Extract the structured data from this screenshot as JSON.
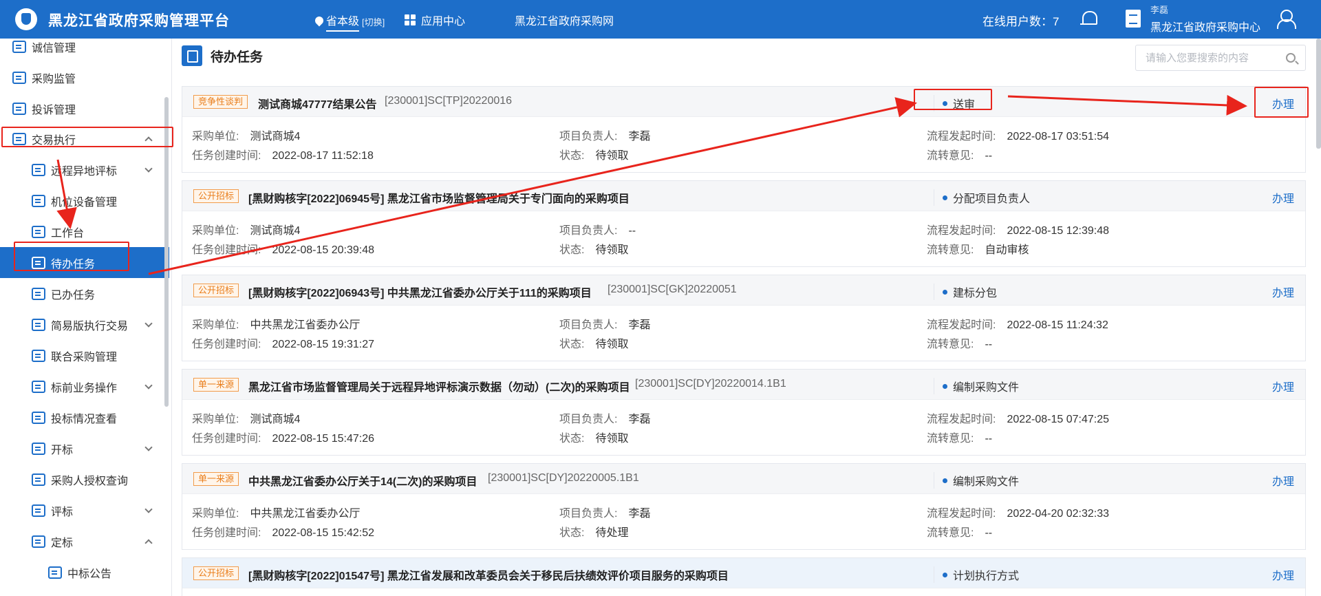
{
  "header": {
    "app_title": "黑龙江省政府采购管理平台",
    "region_name": "省本级",
    "region_switch": "[切换]",
    "app_center": "应用中心",
    "portal_link": "黑龙江省政府采购网",
    "online_users": "在线用户数：7",
    "user_name": "李磊",
    "org_name": "黑龙江省政府采购中心"
  },
  "sidebar": {
    "items": [
      {
        "label": "诚信管理"
      },
      {
        "label": "采购监管"
      },
      {
        "label": "投诉管理"
      },
      {
        "label": "交易执行"
      },
      {
        "label": "远程异地评标"
      },
      {
        "label": "机位设备管理"
      },
      {
        "label": "工作台"
      },
      {
        "label": "待办任务"
      },
      {
        "label": "已办任务"
      },
      {
        "label": "简易版执行交易"
      },
      {
        "label": "联合采购管理"
      },
      {
        "label": "标前业务操作"
      },
      {
        "label": "投标情况查看"
      },
      {
        "label": "开标"
      },
      {
        "label": "采购人授权查询"
      },
      {
        "label": "评标"
      },
      {
        "label": "定标"
      },
      {
        "label": "中标公告"
      }
    ]
  },
  "main": {
    "page_title": "待办任务",
    "search_placeholder": "请输入您要搜索的内容",
    "labels": {
      "purchaser": "采购单位:",
      "manager": "项目负责人:",
      "flow_time": "流程发起时间:",
      "created": "任务创建时间:",
      "status": "状态:",
      "opinion": "流转意见:"
    },
    "action_label": "办理",
    "tasks": [
      {
        "tag": "竞争性谈判",
        "title": "测试商城47777结果公告",
        "code": "[230001]SC[TP]20220016",
        "stage": "送审",
        "purchaser": "测试商城4",
        "manager": "李磊",
        "flow_time": "2022-08-17 03:51:54",
        "created": "2022-08-17 11:52:18",
        "status": "待领取",
        "opinion": "--"
      },
      {
        "tag": "公开招标",
        "title": "[黑财购核字[2022]06945号] 黑龙江省市场监督管理局关于专门面向的采购项目",
        "code": "",
        "stage": "分配项目负责人",
        "purchaser": "测试商城4",
        "manager": "--",
        "flow_time": "2022-08-15 12:39:48",
        "created": "2022-08-15 20:39:48",
        "status": "待领取",
        "opinion": "自动审核"
      },
      {
        "tag": "公开招标",
        "title": "[黑财购核字[2022]06943号] 中共黑龙江省委办公厅关于111的采购项目",
        "code": "[230001]SC[GK]20220051",
        "stage": "建标分包",
        "purchaser": "中共黑龙江省委办公厅",
        "manager": "李磊",
        "flow_time": "2022-08-15 11:24:32",
        "created": "2022-08-15 19:31:27",
        "status": "待领取",
        "opinion": "--"
      },
      {
        "tag": "单一来源",
        "title": "黑龙江省市场监督管理局关于远程异地评标演示数据（勿动）(二次)的采购项目",
        "code": "[230001]SC[DY]20220014.1B1",
        "stage": "编制采购文件",
        "purchaser": "测试商城4",
        "manager": "李磊",
        "flow_time": "2022-08-15 07:47:25",
        "created": "2022-08-15 15:47:26",
        "status": "待领取",
        "opinion": "--"
      },
      {
        "tag": "单一来源",
        "title": "中共黑龙江省委办公厅关于14(二次)的采购项目",
        "code": "[230001]SC[DY]20220005.1B1",
        "stage": "编制采购文件",
        "purchaser": "中共黑龙江省委办公厅",
        "manager": "李磊",
        "flow_time": "2022-04-20 02:32:33",
        "created": "2022-08-15 15:42:52",
        "status": "待处理",
        "opinion": "--"
      },
      {
        "tag": "公开招标",
        "title": "[黑财购核字[2022]01547号] 黑龙江省发展和改革委员会关于移民后扶绩效评价项目服务的采购项目",
        "code": "",
        "stage": "计划执行方式",
        "purchaser": "",
        "manager": "",
        "flow_time": "",
        "created": "",
        "status": "",
        "opinion": ""
      }
    ]
  },
  "colors": {
    "brand": "#1d6ec9",
    "tag_orange": "#e97d1a",
    "annotation_red": "#e8241c"
  }
}
